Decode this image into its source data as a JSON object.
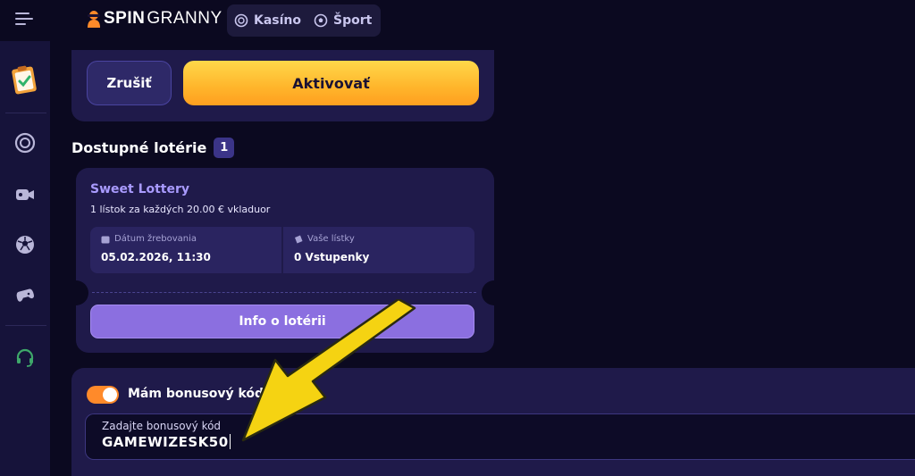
{
  "header": {
    "logo_spin": "SPIN",
    "logo_granny": "GRANNY",
    "nav": [
      {
        "label": "Kasíno",
        "icon": "casino-chip-icon"
      },
      {
        "label": "Šport",
        "icon": "soccer-ball-icon"
      }
    ]
  },
  "sidebar": {
    "items": [
      {
        "icon": "clipboard-checklist-icon"
      },
      {
        "icon": "casino-chip-icon"
      },
      {
        "icon": "live-video-icon"
      },
      {
        "icon": "soccer-ball-icon"
      },
      {
        "icon": "gamepad-icon"
      },
      {
        "icon": "headset-support-icon"
      }
    ]
  },
  "actions": {
    "cancel_label": "Zrušiť",
    "activate_label": "Aktivovať"
  },
  "lotteries": {
    "title": "Dostupné lotérie",
    "count": "1",
    "items": [
      {
        "name": "Sweet Lottery",
        "description": "1 lístok za každých 20.00 € vkladuor",
        "draw_date_label": "Dátum žrebovania",
        "draw_date": "05.02.2026, 11:30",
        "tickets_label": "Vaše lístky",
        "tickets_value": "0 Vstupenky",
        "info_button": "Info o lotérii"
      }
    ]
  },
  "bonus": {
    "toggle_label": "Mám bonusový kód",
    "toggle_on": true,
    "input_placeholder": "Zadajte bonusový kód",
    "input_value": "GAMEWIZESK50"
  },
  "colors": {
    "background": "#0b0920",
    "panel": "#1f1a4a",
    "accent_yellow": "#ffc23a",
    "accent_purple": "#8b6fe0",
    "toggle_orange": "#ff8a2a",
    "arrow_yellow": "#f5d312"
  }
}
